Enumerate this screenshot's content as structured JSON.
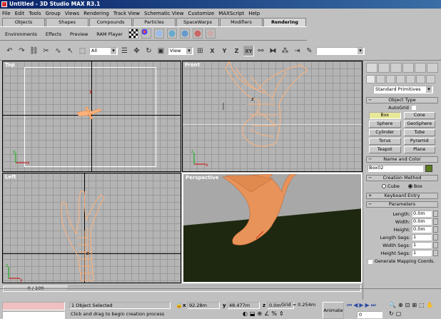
{
  "window": {
    "title": "Untitled - 3D Studio MAX R3.1"
  },
  "menu": [
    "File",
    "Edit",
    "Tools",
    "Group",
    "Views",
    "Rendering",
    "Track View",
    "Schematic View",
    "Customize",
    "MAXScript",
    "Help"
  ],
  "tabs": [
    {
      "label": "Objects",
      "w": 62
    },
    {
      "label": "Shapes",
      "w": 62
    },
    {
      "label": "Compounds",
      "w": 62
    },
    {
      "label": "Particles",
      "w": 62
    },
    {
      "label": "SpaceWarps",
      "w": 62
    },
    {
      "label": "Modifiers",
      "w": 62
    },
    {
      "label": "Rendering",
      "w": 62,
      "active": true
    }
  ],
  "tab_tools": {
    "environments": "Environments",
    "effects": "Effects",
    "preview": "Preview",
    "ram_player": "RAM Player"
  },
  "toolbar": {
    "selection_filter": "All",
    "ref_coord": "View",
    "xy_label": "XY",
    "axis_x": "X",
    "axis_y": "Y",
    "axis_z": "Z",
    "named_sel": ""
  },
  "viewports": {
    "top": {
      "label": "Top"
    },
    "front": {
      "label": "Front"
    },
    "left": {
      "label": "Left"
    },
    "perspective": {
      "label": "Perspective"
    }
  },
  "axis_labels": {
    "x": "x",
    "y": "y",
    "z": "z"
  },
  "command_panel": {
    "category": "Standard Primitives",
    "object_type_title": "Object Type",
    "autogrid": "AutoGrid",
    "buttons": [
      "Box",
      "Cone",
      "Sphere",
      "GeoSphere",
      "Cylinder",
      "Tube",
      "Torus",
      "Pyramid",
      "Teapot",
      "Plane"
    ],
    "active_button": "Box",
    "name_color_title": "Name and Color",
    "name_value": "Box02",
    "object_color": "#5e7a1e",
    "creation_method_title": "Creation Method",
    "creation_cube": "Cube",
    "creation_box": "Box",
    "keyboard_entry_title": "Keyboard Entry",
    "parameters_title": "Parameters",
    "params": [
      {
        "label": "Length:",
        "value": "0.0m"
      },
      {
        "label": "Width:",
        "value": "0.0m"
      },
      {
        "label": "Height:",
        "value": "0.0m"
      },
      {
        "label": "Length Segs:",
        "value": "1"
      },
      {
        "label": "Width Segs:",
        "value": "1"
      },
      {
        "label": "Height Segs:",
        "value": "1"
      }
    ],
    "gen_mapping": "Generate Mapping Coords."
  },
  "status": {
    "frame": "0 / 100",
    "selected": "1 Object Selected",
    "prompt": "Click and drag to begin creation process",
    "x": "92.28m",
    "y": "48.477m",
    "z": "0.0m",
    "grid": "Grid = 0.254m",
    "animate": "Animate",
    "frame_field": "0"
  },
  "colors": {
    "mesh": "#e8935a",
    "wire": "#ffb27a",
    "ground": "#1e2810",
    "sky": "#a8a8a8",
    "title_start": "#0a246a"
  }
}
